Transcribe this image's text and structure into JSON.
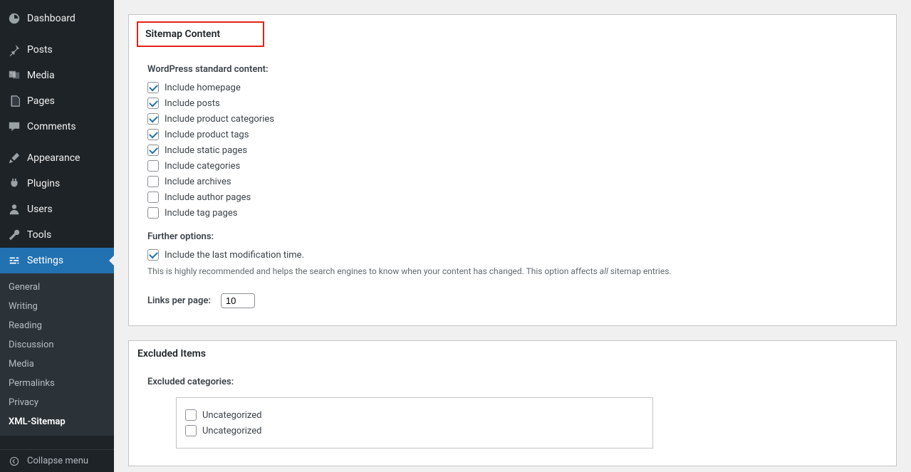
{
  "sidebar": {
    "dashboard_label": "Dashboard",
    "posts_label": "Posts",
    "media_label": "Media",
    "pages_label": "Pages",
    "comments_label": "Comments",
    "appearance_label": "Appearance",
    "plugins_label": "Plugins",
    "users_label": "Users",
    "tools_label": "Tools",
    "settings_label": "Settings",
    "submenu": {
      "general": "General",
      "writing": "Writing",
      "reading": "Reading",
      "discussion": "Discussion",
      "media": "Media",
      "permalinks": "Permalinks",
      "privacy": "Privacy",
      "xml_sitemap": "XML-Sitemap"
    },
    "collapse_label": "Collapse menu"
  },
  "sitemap_content": {
    "title": "Sitemap Content",
    "standard_heading": "WordPress standard content:",
    "opts": {
      "homepage": "Include homepage",
      "posts": "Include posts",
      "product_categories": "Include product categories",
      "product_tags": "Include product tags",
      "static_pages": "Include static pages",
      "categories": "Include categories",
      "archives": "Include archives",
      "author_pages": "Include author pages",
      "tag_pages": "Include tag pages"
    },
    "further_heading": "Further options:",
    "last_mod_label": "Include the last modification time.",
    "last_mod_help_pre": "This is highly recommended and helps the search engines to know when your content has changed. This option affects ",
    "last_mod_help_em": "all",
    "last_mod_help_post": " sitemap entries.",
    "links_label": "Links per page:",
    "links_value": "10"
  },
  "excluded": {
    "title": "Excluded Items",
    "categories_heading": "Excluded categories:",
    "items": {
      "uncategorized1": "Uncategorized",
      "uncategorized2": "Uncategorized"
    }
  }
}
